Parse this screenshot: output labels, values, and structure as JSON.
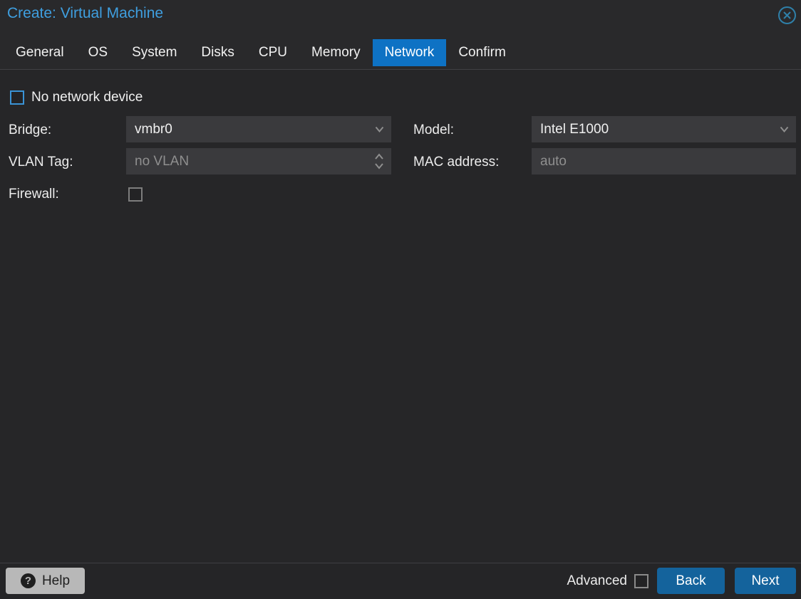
{
  "window": {
    "title": "Create: Virtual Machine"
  },
  "tabs": [
    {
      "label": "General",
      "active": false
    },
    {
      "label": "OS",
      "active": false
    },
    {
      "label": "System",
      "active": false
    },
    {
      "label": "Disks",
      "active": false
    },
    {
      "label": "CPU",
      "active": false
    },
    {
      "label": "Memory",
      "active": false
    },
    {
      "label": "Network",
      "active": true
    },
    {
      "label": "Confirm",
      "active": false
    }
  ],
  "form": {
    "no_network_device": {
      "label": "No network device",
      "checked": false
    },
    "bridge": {
      "label": "Bridge:",
      "value": "vmbr0",
      "type": "dropdown"
    },
    "model": {
      "label": "Model:",
      "value": "Intel E1000",
      "type": "dropdown"
    },
    "vlan_tag": {
      "label": "VLAN Tag:",
      "value": "",
      "placeholder": "no VLAN",
      "type": "number-spinner"
    },
    "mac_address": {
      "label": "MAC address:",
      "value": "",
      "placeholder": "auto",
      "type": "text"
    },
    "firewall": {
      "label": "Firewall:",
      "checked": false
    }
  },
  "footer": {
    "help_label": "Help",
    "help_icon_glyph": "?",
    "advanced_label": "Advanced",
    "advanced_checked": false,
    "back_label": "Back",
    "next_label": "Next"
  },
  "icons": {
    "close": "circle-x-icon",
    "dropdown": "chevron-down-icon",
    "spinner": "chevron-up-down-icon",
    "help": "question-circle-icon"
  },
  "colors": {
    "title_blue": "#3f9fe0",
    "tab_active_bg": "#0e72c4",
    "button_blue": "#14639c",
    "checkbox_accent": "#3a93d6",
    "field_bg": "#3a3a3d",
    "placeholder_gray": "#8f8f8f",
    "header_bg": "#29292b",
    "body_bg": "#262628",
    "close_icon_stroke": "#2f80a9"
  }
}
